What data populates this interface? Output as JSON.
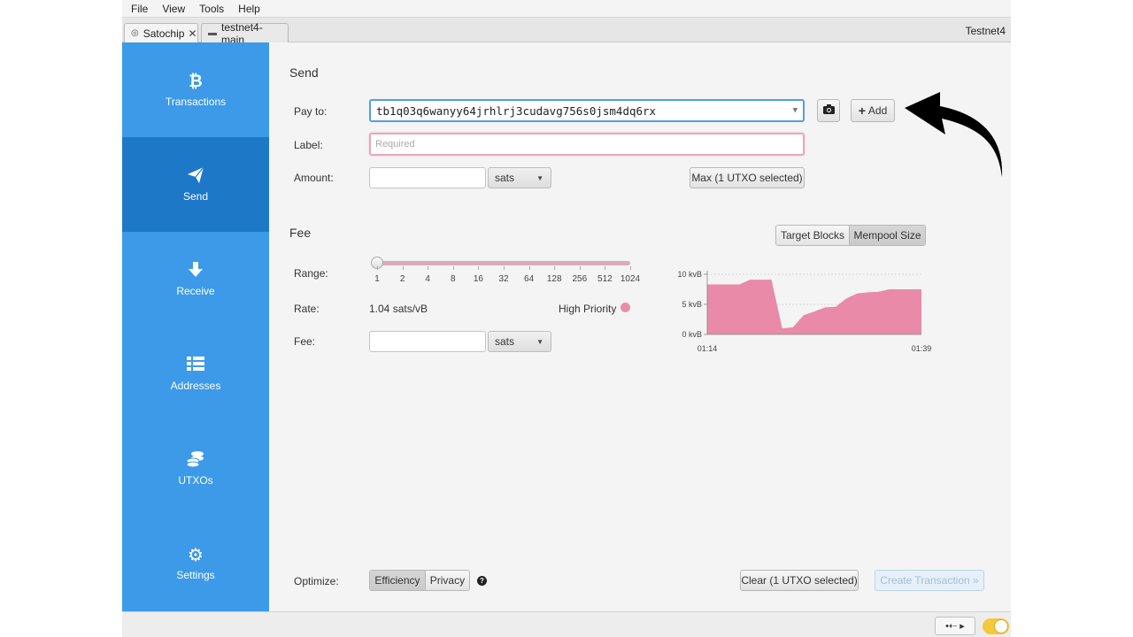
{
  "menu": [
    "File",
    "View",
    "Tools",
    "Help"
  ],
  "tabs": [
    {
      "label": "Satochip",
      "icon": "globe-icon",
      "close": "✕"
    },
    {
      "label": "testnet4-main",
      "icon": "wallet-icon"
    }
  ],
  "network": "Testnet4",
  "sidebar": {
    "items": [
      {
        "label": "Transactions",
        "icon": "bitcoin-icon"
      },
      {
        "label": "Send",
        "icon": "paper-plane-icon",
        "active": true
      },
      {
        "label": "Receive",
        "icon": "arrow-down-icon"
      },
      {
        "label": "Addresses",
        "icon": "list-icon"
      },
      {
        "label": "UTXOs",
        "icon": "coins-icon"
      },
      {
        "label": "Settings",
        "icon": "gear-icon"
      }
    ]
  },
  "send": {
    "title": "Send",
    "pay_to_label": "Pay to:",
    "pay_to_value": "tb1q03q6wanyy64jrhlrj3cudavg756s0jsm4dq6rx",
    "label_label": "Label:",
    "label_placeholder": "Required",
    "amount_label": "Amount:",
    "amount_value": "",
    "amount_unit": "sats",
    "max_button": "Max (1 UTXO selected)",
    "add_button": "Add"
  },
  "fee": {
    "title": "Fee",
    "mode_target": "Target Blocks",
    "mode_mempool": "Mempool Size",
    "selected_mode": "Mempool Size",
    "range_label": "Range:",
    "range_ticks": [
      "1",
      "2",
      "4",
      "8",
      "16",
      "32",
      "64",
      "128",
      "256",
      "512",
      "1024"
    ],
    "slider_value": 0.0,
    "rate_label": "Rate:",
    "rate_value": "1.04 sats/vB",
    "priority_label": "High Priority",
    "priority_color": "#e78fa9",
    "fee_label": "Fee:",
    "fee_value": "",
    "fee_unit": "sats"
  },
  "chart_data": {
    "type": "area",
    "x": [
      "01:14",
      "01:16",
      "01:18",
      "01:20",
      "01:21",
      "01:22",
      "01:23",
      "01:24",
      "01:25",
      "01:26",
      "01:27",
      "01:28",
      "01:29",
      "01:30",
      "01:31",
      "01:32",
      "01:33",
      "01:34",
      "01:35",
      "01:37",
      "01:39"
    ],
    "values": [
      8.3,
      8.3,
      8.3,
      8.3,
      9.1,
      9.1,
      9.1,
      1.0,
      1.2,
      3.2,
      3.8,
      4.5,
      4.6,
      6.0,
      6.8,
      7.0,
      7.1,
      7.5,
      7.5,
      7.5,
      7.5
    ],
    "yticks": [
      "0 kvB",
      "5 kvB",
      "10 kvB"
    ],
    "ylim": [
      0,
      10
    ],
    "xtick_labels": [
      "01:14",
      "01:39"
    ],
    "color": "#e88aa8",
    "grid": true
  },
  "footer": {
    "optimize_label": "Optimize:",
    "efficiency": "Efficiency",
    "privacy": "Privacy",
    "selected": "Efficiency",
    "clear_button": "Clear (1 UTXO selected)",
    "create_button": "Create Transaction »"
  },
  "status": {
    "usb": "•⇠ ▸",
    "toggle_color": "#f6c83c"
  }
}
